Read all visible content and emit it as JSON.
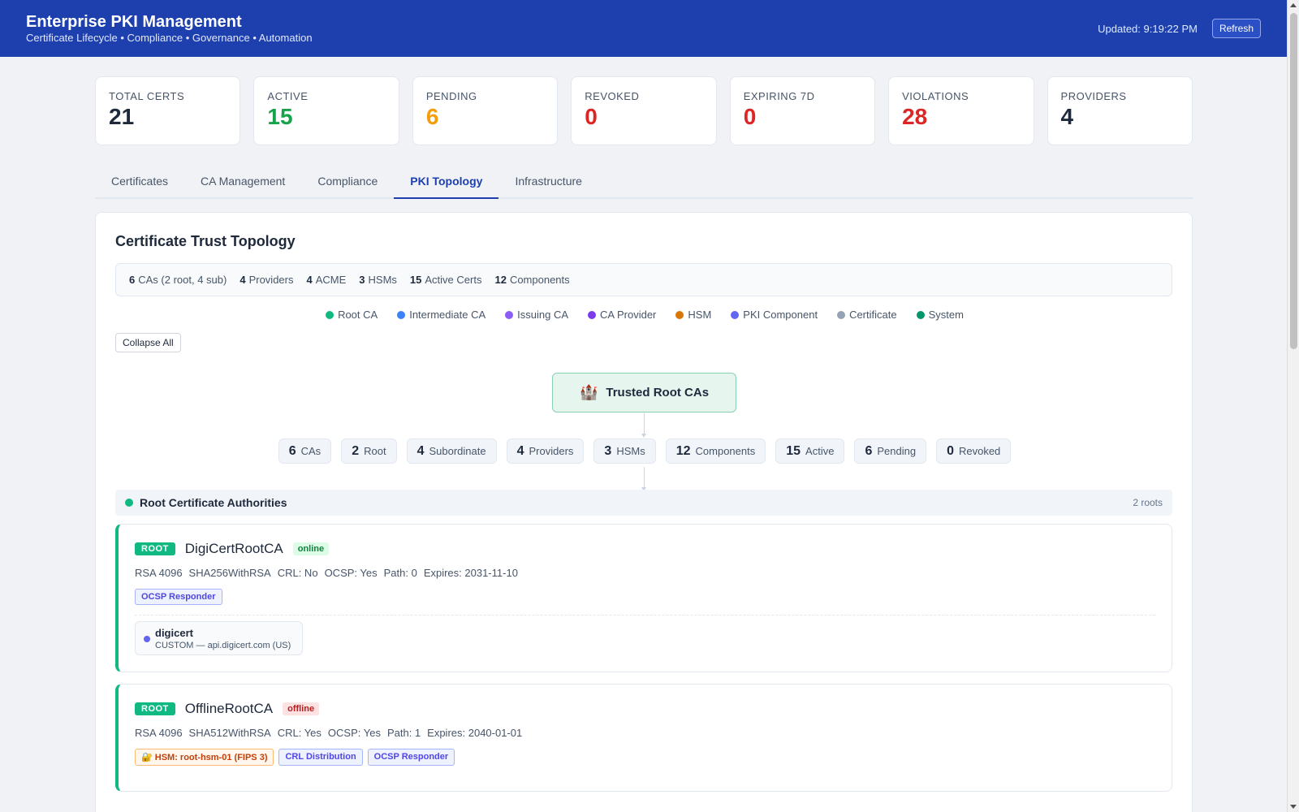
{
  "header": {
    "title": "Enterprise PKI Management",
    "subtitle": "Certificate Lifecycle • Compliance • Governance • Automation",
    "updated": "Updated: 9:19:22 PM",
    "refresh_label": "Refresh"
  },
  "stats": [
    {
      "label": "TOTAL CERTS",
      "value": "21",
      "color": "#1e293b"
    },
    {
      "label": "ACTIVE",
      "value": "15",
      "color": "#16a34a"
    },
    {
      "label": "PENDING",
      "value": "6",
      "color": "#f59e0b"
    },
    {
      "label": "REVOKED",
      "value": "0",
      "color": "#dc2626"
    },
    {
      "label": "EXPIRING 7D",
      "value": "0",
      "color": "#dc2626"
    },
    {
      "label": "VIOLATIONS",
      "value": "28",
      "color": "#dc2626"
    },
    {
      "label": "PROVIDERS",
      "value": "4",
      "color": "#1e293b"
    }
  ],
  "tabs": [
    {
      "label": "Certificates",
      "active": false
    },
    {
      "label": "CA Management",
      "active": false
    },
    {
      "label": "Compliance",
      "active": false
    },
    {
      "label": "PKI Topology",
      "active": true
    },
    {
      "label": "Infrastructure",
      "active": false
    }
  ],
  "topology": {
    "title": "Certificate Trust Topology",
    "summary": [
      {
        "num": "6",
        "text": "CAs (2 root, 4 sub)"
      },
      {
        "num": "4",
        "text": "Providers"
      },
      {
        "num": "4",
        "text": "ACME"
      },
      {
        "num": "3",
        "text": "HSMs"
      },
      {
        "num": "15",
        "text": "Active Certs"
      },
      {
        "num": "12",
        "text": "Components"
      }
    ],
    "legend": [
      {
        "label": "Root CA",
        "color": "#10b981"
      },
      {
        "label": "Intermediate CA",
        "color": "#3b82f6"
      },
      {
        "label": "Issuing CA",
        "color": "#8b5cf6"
      },
      {
        "label": "CA Provider",
        "color": "#7c3aed"
      },
      {
        "label": "HSM",
        "color": "#d97706"
      },
      {
        "label": "PKI Component",
        "color": "#6366f1"
      },
      {
        "label": "Certificate",
        "color": "#94a3b8"
      },
      {
        "label": "System",
        "color": "#059669"
      }
    ],
    "collapse_label": "Collapse All",
    "root_node_label": "Trusted Root CAs",
    "root_node_icon": "castle-icon",
    "chips": [
      {
        "num": "6",
        "text": "CAs"
      },
      {
        "num": "2",
        "text": "Root"
      },
      {
        "num": "4",
        "text": "Subordinate"
      },
      {
        "num": "4",
        "text": "Providers"
      },
      {
        "num": "3",
        "text": "HSMs"
      },
      {
        "num": "12",
        "text": "Components"
      },
      {
        "num": "15",
        "text": "Active"
      },
      {
        "num": "6",
        "text": "Pending"
      },
      {
        "num": "0",
        "text": "Revoked"
      }
    ],
    "section": {
      "label": "Root Certificate Authorities",
      "count": "2 roots"
    },
    "cas": [
      {
        "badge": "ROOT",
        "name": "DigiCertRootCA",
        "status": "online",
        "meta": [
          "RSA 4096",
          "SHA256WithRSA",
          "CRL: No",
          "OCSP: Yes",
          "Path: 0",
          "Expires: 2031-11-10"
        ],
        "tags": [
          {
            "label": "OCSP Responder",
            "style": "blue"
          }
        ],
        "provider": {
          "name": "digicert",
          "desc": "CUSTOM — api.digicert.com (US)"
        }
      },
      {
        "badge": "ROOT",
        "name": "OfflineRootCA",
        "status": "offline",
        "meta": [
          "RSA 4096",
          "SHA512WithRSA",
          "CRL: Yes",
          "OCSP: Yes",
          "Path: 1",
          "Expires: 2040-01-01"
        ],
        "tags": [
          {
            "label": "🔐 HSM: root-hsm-01 (FIPS 3)",
            "style": "amber"
          },
          {
            "label": "CRL Distribution",
            "style": "blue"
          },
          {
            "label": "OCSP Responder",
            "style": "blue"
          }
        ]
      }
    ]
  }
}
